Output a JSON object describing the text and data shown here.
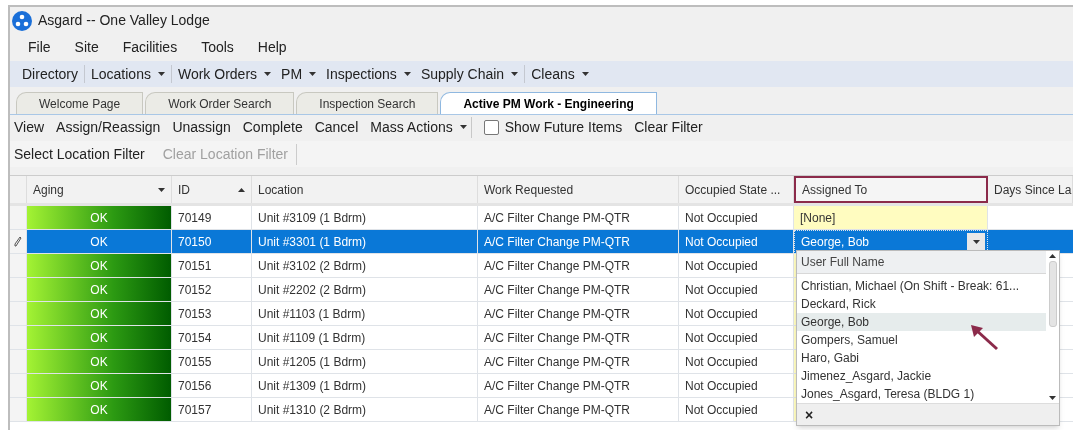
{
  "window": {
    "title": "Asgard -- One Valley Lodge"
  },
  "menu_bar": [
    "File",
    "Site",
    "Facilities",
    "Tools",
    "Help"
  ],
  "nav_toolbar": [
    {
      "label": "Directory",
      "has_menu": false
    },
    {
      "label": "Locations",
      "has_menu": true
    },
    {
      "label": "Work Orders",
      "has_menu": true
    },
    {
      "label": "PM",
      "has_menu": true
    },
    {
      "label": "Inspections",
      "has_menu": true
    },
    {
      "label": "Supply Chain",
      "has_menu": true
    },
    {
      "label": "Cleans",
      "has_menu": true
    }
  ],
  "tabs": [
    {
      "label": "Welcome Page",
      "selected": false
    },
    {
      "label": "Work Order Search",
      "selected": false
    },
    {
      "label": "Inspection Search",
      "selected": false
    },
    {
      "label": "Active PM Work - Engineering",
      "selected": true
    }
  ],
  "actions": [
    {
      "kind": "button",
      "label": "View"
    },
    {
      "kind": "button",
      "label": "Assign/Reassign"
    },
    {
      "kind": "button",
      "label": "Unassign"
    },
    {
      "kind": "button",
      "label": "Complete"
    },
    {
      "kind": "button",
      "label": "Cancel"
    },
    {
      "kind": "menu",
      "label": "Mass Actions"
    },
    {
      "kind": "checkbox",
      "label": "Show Future Items",
      "checked": false
    },
    {
      "kind": "button",
      "label": "Clear Filter"
    }
  ],
  "location_filter": [
    {
      "label": "Select Location Filter",
      "disabled": false
    },
    {
      "label": "Clear Location Filter",
      "disabled": true
    }
  ],
  "table": {
    "columns": [
      {
        "label": "Aging",
        "kind": "filter",
        "focused": false
      },
      {
        "label": "ID",
        "kind": "sort_asc",
        "focused": false
      },
      {
        "label": "Location",
        "kind": "plain",
        "focused": false
      },
      {
        "label": "Work Requested",
        "kind": "plain",
        "focused": false
      },
      {
        "label": "Occupied State ...",
        "kind": "plain",
        "focused": false
      },
      {
        "label": "Assigned To",
        "kind": "plain",
        "focused": true
      },
      {
        "label": "Days Since La",
        "kind": "plain",
        "focused": false
      }
    ],
    "rows": [
      {
        "aging": "OK",
        "id": "70149",
        "location": "Unit #3109 (1 Bdrm)",
        "work": "A/C Filter Change PM-QTR",
        "occupied": "Not Occupied",
        "assigned": "[None]",
        "selected": false,
        "editing": false
      },
      {
        "aging": "OK",
        "id": "70150",
        "location": "Unit #3301 (1 Bdrm)",
        "work": "A/C Filter Change PM-QTR",
        "occupied": "Not Occupied",
        "assigned": "George, Bob",
        "selected": true,
        "editing": true
      },
      {
        "aging": "OK",
        "id": "70151",
        "location": "Unit #3102 (2 Bdrm)",
        "work": "A/C Filter Change PM-QTR",
        "occupied": "Not Occupied",
        "selected": false,
        "editing": false
      },
      {
        "aging": "OK",
        "id": "70152",
        "location": "Unit #2202 (2 Bdrm)",
        "work": "A/C Filter Change PM-QTR",
        "occupied": "Not Occupied",
        "selected": false,
        "editing": false
      },
      {
        "aging": "OK",
        "id": "70153",
        "location": "Unit #1103 (1 Bdrm)",
        "work": "A/C Filter Change PM-QTR",
        "occupied": "Not Occupied",
        "selected": false,
        "editing": false
      },
      {
        "aging": "OK",
        "id": "70154",
        "location": "Unit #1109 (1 Bdrm)",
        "work": "A/C Filter Change PM-QTR",
        "occupied": "Not Occupied",
        "selected": false,
        "editing": false
      },
      {
        "aging": "OK",
        "id": "70155",
        "location": "Unit #1205 (1 Bdrm)",
        "work": "A/C Filter Change PM-QTR",
        "occupied": "Not Occupied",
        "selected": false,
        "editing": false
      },
      {
        "aging": "OK",
        "id": "70156",
        "location": "Unit #1309 (1 Bdrm)",
        "work": "A/C Filter Change PM-QTR",
        "occupied": "Not Occupied",
        "selected": false,
        "editing": false
      },
      {
        "aging": "OK",
        "id": "70157",
        "location": "Unit #1310 (2 Bdrm)",
        "work": "A/C Filter Change PM-QTR",
        "occupied": "Not Occupied",
        "selected": false,
        "editing": false
      }
    ]
  },
  "dropdown": {
    "header": "User Full Name",
    "close": "×",
    "items": [
      {
        "label": "Christian, Michael (On Shift - Break: 61...",
        "selected": false
      },
      {
        "label": "Deckard, Rick",
        "selected": false
      },
      {
        "label": "George, Bob",
        "selected": true
      },
      {
        "label": "Gompers, Samuel",
        "selected": false
      },
      {
        "label": "Haro, Gabi",
        "selected": false
      },
      {
        "label": "Jimenez_Asgard, Jackie",
        "selected": false
      },
      {
        "label": "Jones_Asgard, Teresa (BLDG 1)",
        "selected": false
      }
    ]
  }
}
